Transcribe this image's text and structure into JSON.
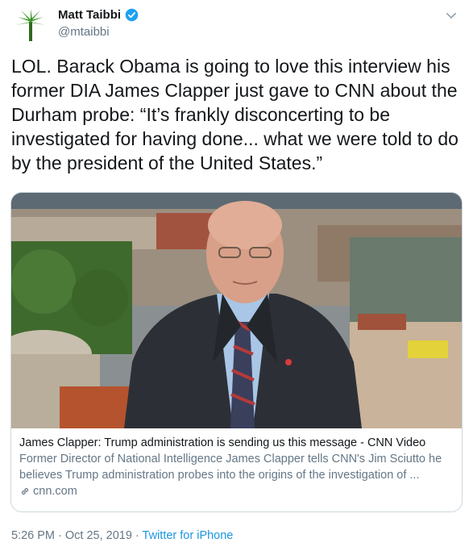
{
  "author": {
    "display_name": "Matt Taibbi",
    "handle": "@mtaibbi",
    "avatar_icon": "palm-tree-icon",
    "verified_color": "#1da1f2"
  },
  "tweet": {
    "text": "LOL. Barack Obama is going to love this interview his former DIA James Clapper just gave to CNN about the Durham probe: “It’s frankly disconcerting to be investigated for having done...  what we were told to do by the president of the United States.”"
  },
  "card": {
    "title": "James Clapper: Trump administration is sending us this message - CNN Video",
    "description_line1": "Former Director of National Intelligence James Clapper tells CNN's Jim Sciutto he",
    "description_line2": "believes Trump administration probes into the origins of the investigation of ...",
    "domain": "cnn.com"
  },
  "meta": {
    "time": "5:26 PM",
    "separator": " · ",
    "date": "Oct 25, 2019",
    "separator2": " · ",
    "source": "Twitter for iPhone"
  },
  "colors": {
    "link_blue": "#1b95e0",
    "secondary_text": "#657786",
    "border": "#ccd6dd"
  }
}
